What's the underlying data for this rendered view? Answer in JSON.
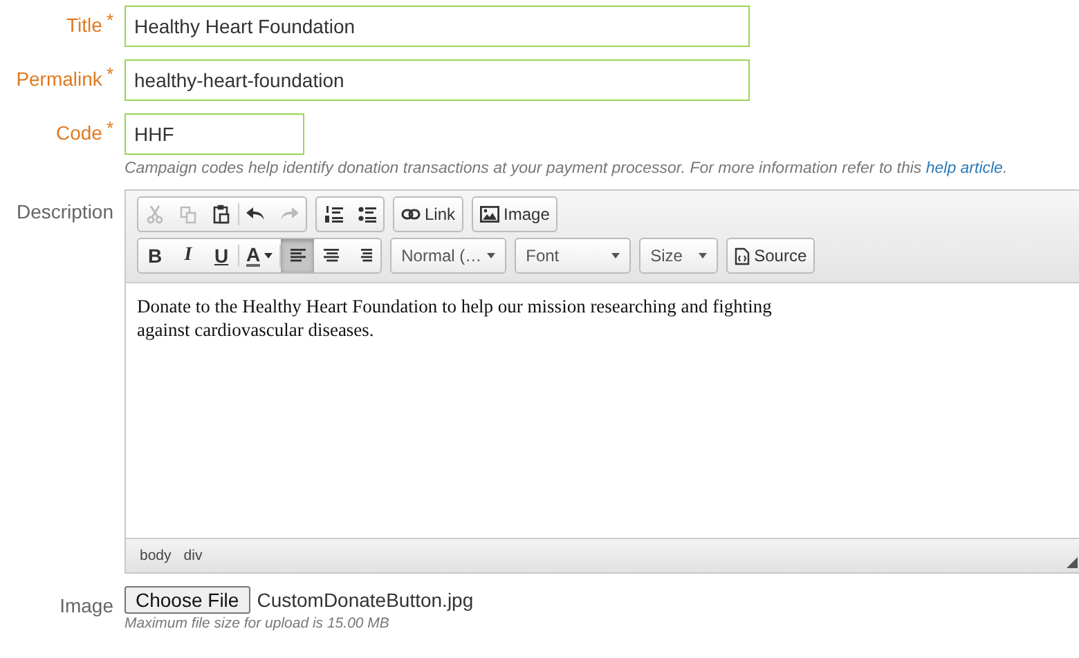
{
  "fields": [
    {
      "label": "Title",
      "required_mark": "*",
      "value": "Healthy Heart Foundation"
    },
    {
      "label": "Permalink",
      "required_mark": "*",
      "value": "healthy-heart-foundation"
    },
    {
      "label": "Code",
      "required_mark": "*",
      "value": "HHF",
      "hint": "Campaign codes help identify donation transactions at your payment processor. For more information refer to this ",
      "hint_link": "help article",
      "hint_end": "."
    }
  ],
  "description": {
    "label": "Description",
    "toolbar": [
      [
        {
          "items": [
            {
              "kind": "cut",
              "disabled": true
            },
            {
              "kind": "copy",
              "disabled": true
            },
            {
              "kind": "paste",
              "disabled": false
            },
            {
              "kind": "sep"
            },
            {
              "kind": "undo",
              "disabled": false
            },
            {
              "kind": "redo",
              "disabled": true
            }
          ]
        },
        {
          "items": [
            {
              "kind": "numlist",
              "disabled": false
            },
            {
              "kind": "bullist",
              "disabled": false
            }
          ]
        },
        {
          "items": [
            {
              "kind": "link",
              "text": "Link",
              "disabled": false
            }
          ]
        },
        {
          "items": [
            {
              "kind": "image",
              "text": "Image",
              "disabled": false
            }
          ]
        }
      ],
      [
        {
          "items": [
            {
              "kind": "bold",
              "text": "B",
              "disabled": false
            },
            {
              "kind": "italic",
              "text": "I",
              "disabled": false
            },
            {
              "kind": "underline",
              "text": "U",
              "disabled": false
            },
            {
              "kind": "sep"
            },
            {
              "kind": "color",
              "text": "A",
              "disabled": false
            },
            {
              "kind": "sep"
            },
            {
              "kind": "alignleft",
              "disabled": false,
              "selected": true
            },
            {
              "kind": "aligncenter",
              "disabled": false,
              "selected": false
            },
            {
              "kind": "alignright",
              "disabled": false,
              "selected": false
            }
          ]
        },
        {
          "items": [
            {
              "kind": "select",
              "text": "Normal (…"
            }
          ]
        },
        {
          "items": [
            {
              "kind": "select",
              "text": "Font"
            }
          ]
        },
        {
          "items": [
            {
              "kind": "select",
              "text": "Size"
            }
          ]
        },
        {
          "items": [
            {
              "kind": "source",
              "text": "Source",
              "disabled": false
            }
          ]
        }
      ]
    ],
    "content": "Donate to the Healthy Heart Foundation to help our mission researching and fighting\nagainst cardiovascular diseases.",
    "path": [
      "body",
      "div"
    ]
  },
  "image": {
    "label": "Image",
    "button": "Choose File",
    "file": "CustomDonateButton.jpg",
    "hint": "Maximum file size for upload is 15.00 MB"
  }
}
